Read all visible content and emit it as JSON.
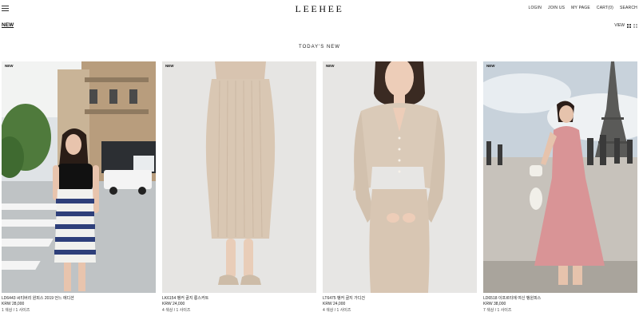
{
  "header": {
    "logo": "LEEHEE",
    "nav": [
      "LOGIN",
      "JOIN US",
      "MY PAGE",
      "CART(0)",
      "SEARCH"
    ]
  },
  "category": {
    "label": "NEW"
  },
  "view": {
    "label": "VIEW"
  },
  "section": {
    "title": "TODAY'S NEW"
  },
  "products": [
    {
      "badge": "NEW",
      "name": "LD6443 씨티버리 원피스 2019 언느 에디션",
      "price": "KRW 28,000",
      "meta": "1 색상 / 1 사이즈"
    },
    {
      "badge": "NEW",
      "name": "LK6154 뱅커 골지 롱스커트",
      "price": "KRW 24,000",
      "meta": "4 색상 / 1 사이즈"
    },
    {
      "badge": "NEW",
      "name": "LT6475 뱅커 골지 가디건",
      "price": "KRW 24,000",
      "meta": "4 색상 / 1 사이즈"
    },
    {
      "badge": "NEW",
      "name": "LD6518 이프르티에 여신 뱅원피스",
      "price": "KRW 38,000",
      "meta": "7 색상 / 1 사이즈"
    }
  ],
  "colors": {
    "accent": "#111111",
    "text": "#222222",
    "background": "#ffffff"
  }
}
